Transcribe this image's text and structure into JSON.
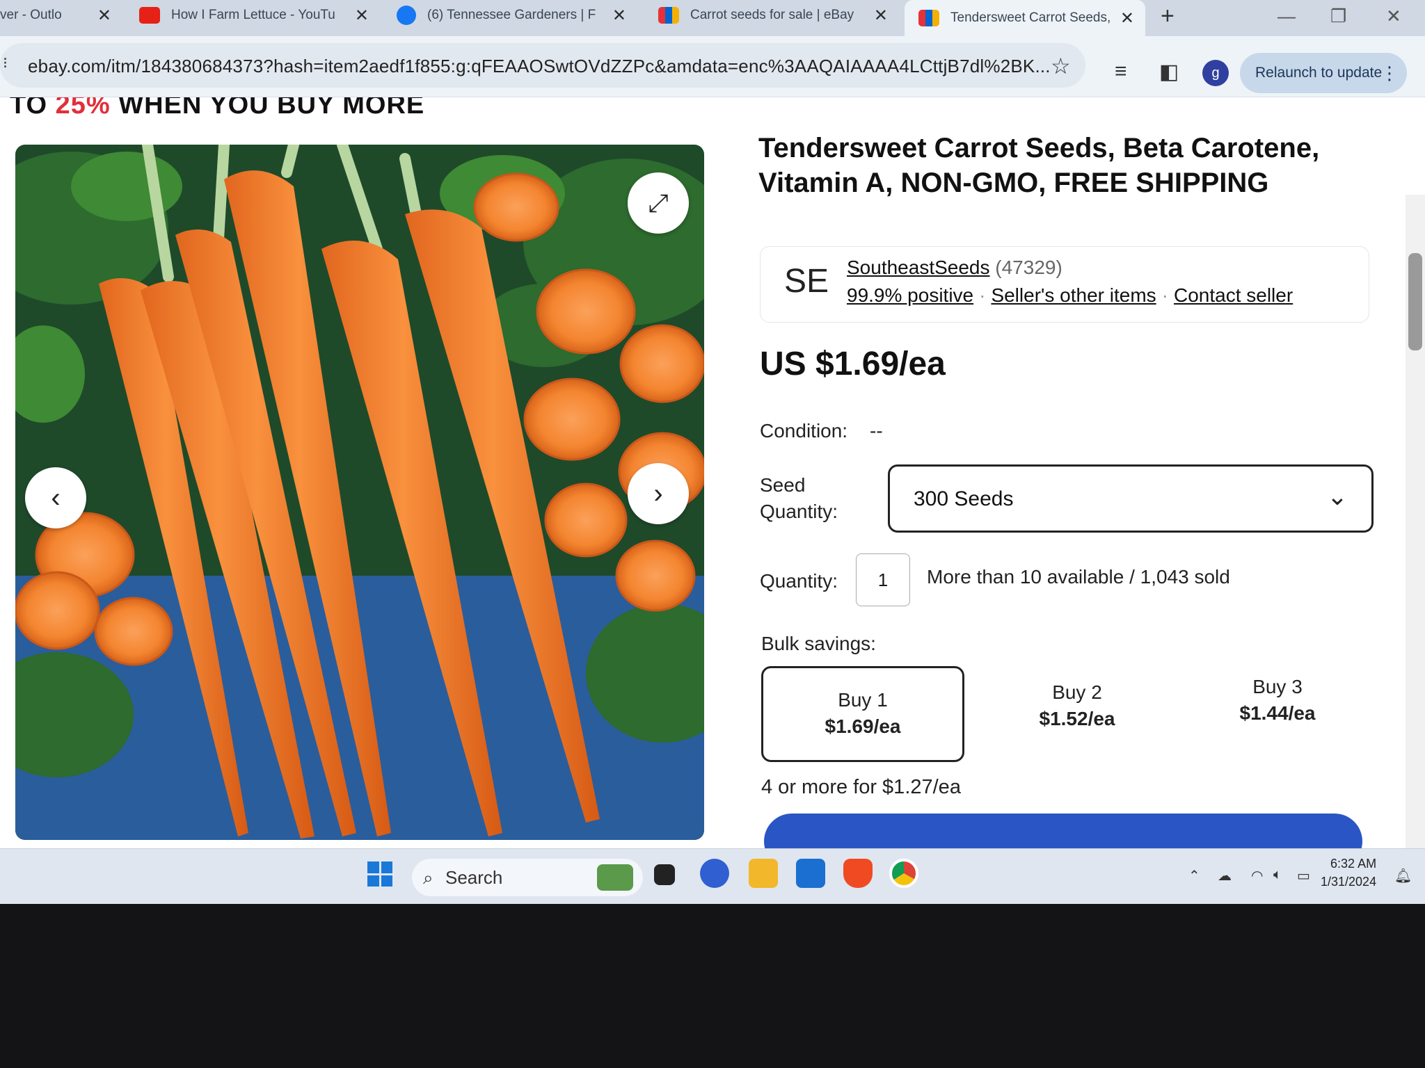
{
  "browser": {
    "tabs": [
      {
        "title": "ver - Outlo",
        "active": false
      },
      {
        "title": "How I Farm Lettuce - YouTu",
        "active": false
      },
      {
        "title": "(6) Tennessee Gardeners | F",
        "active": false
      },
      {
        "title": "Carrot seeds for sale | eBay",
        "active": false
      },
      {
        "title": "Tendersweet Carrot Seeds, F",
        "active": true
      }
    ],
    "new_tab": "+",
    "url": "ebay.com/itm/184380684373?hash=item2aedf1f855:g:qFEAAOSwtOVdZZPc&amdata=enc%3AAQAIAAAA4LCttjB7dl%2BK...",
    "profile_initial": "g",
    "relaunch_label": "Relaunch to update"
  },
  "promo": {
    "prefix": "TO ",
    "highlight": "25%",
    "suffix": " WHEN YOU BUY MORE",
    "highlight_color": "#e0303a"
  },
  "product": {
    "title": "Tendersweet Carrot Seeds, Beta Carotene, Vitamin A, NON-GMO, FREE SHIPPING",
    "seller": {
      "initials": "SE",
      "name": "SoutheastSeeds",
      "feedback_count": "(47329)",
      "positive": "99.9% positive",
      "other_items": "Seller's other items",
      "contact": "Contact seller"
    },
    "price": "US $1.69/ea",
    "condition_label": "Condition:",
    "condition_value": "--",
    "seed_qty_label_1": "Seed",
    "seed_qty_label_2": "Quantity:",
    "seed_qty_selected": "300 Seeds",
    "quantity_label": "Quantity:",
    "quantity_value": "1",
    "availability": "More than 10 available / 1,043 sold",
    "bulk_label": "Bulk savings:",
    "bulk_tiers": [
      {
        "label": "Buy 1",
        "price": "$1.69/ea",
        "selected": true
      },
      {
        "label": "Buy 2",
        "price": "$1.52/ea",
        "selected": false
      },
      {
        "label": "Buy 3",
        "price": "$1.44/ea",
        "selected": false
      }
    ],
    "bulk_more": "4 or more for $1.27/ea",
    "accent_color": "#2a55c4"
  },
  "taskbar": {
    "search_placeholder": "Search",
    "time": "6:32 AM",
    "date": "1/31/2024"
  }
}
